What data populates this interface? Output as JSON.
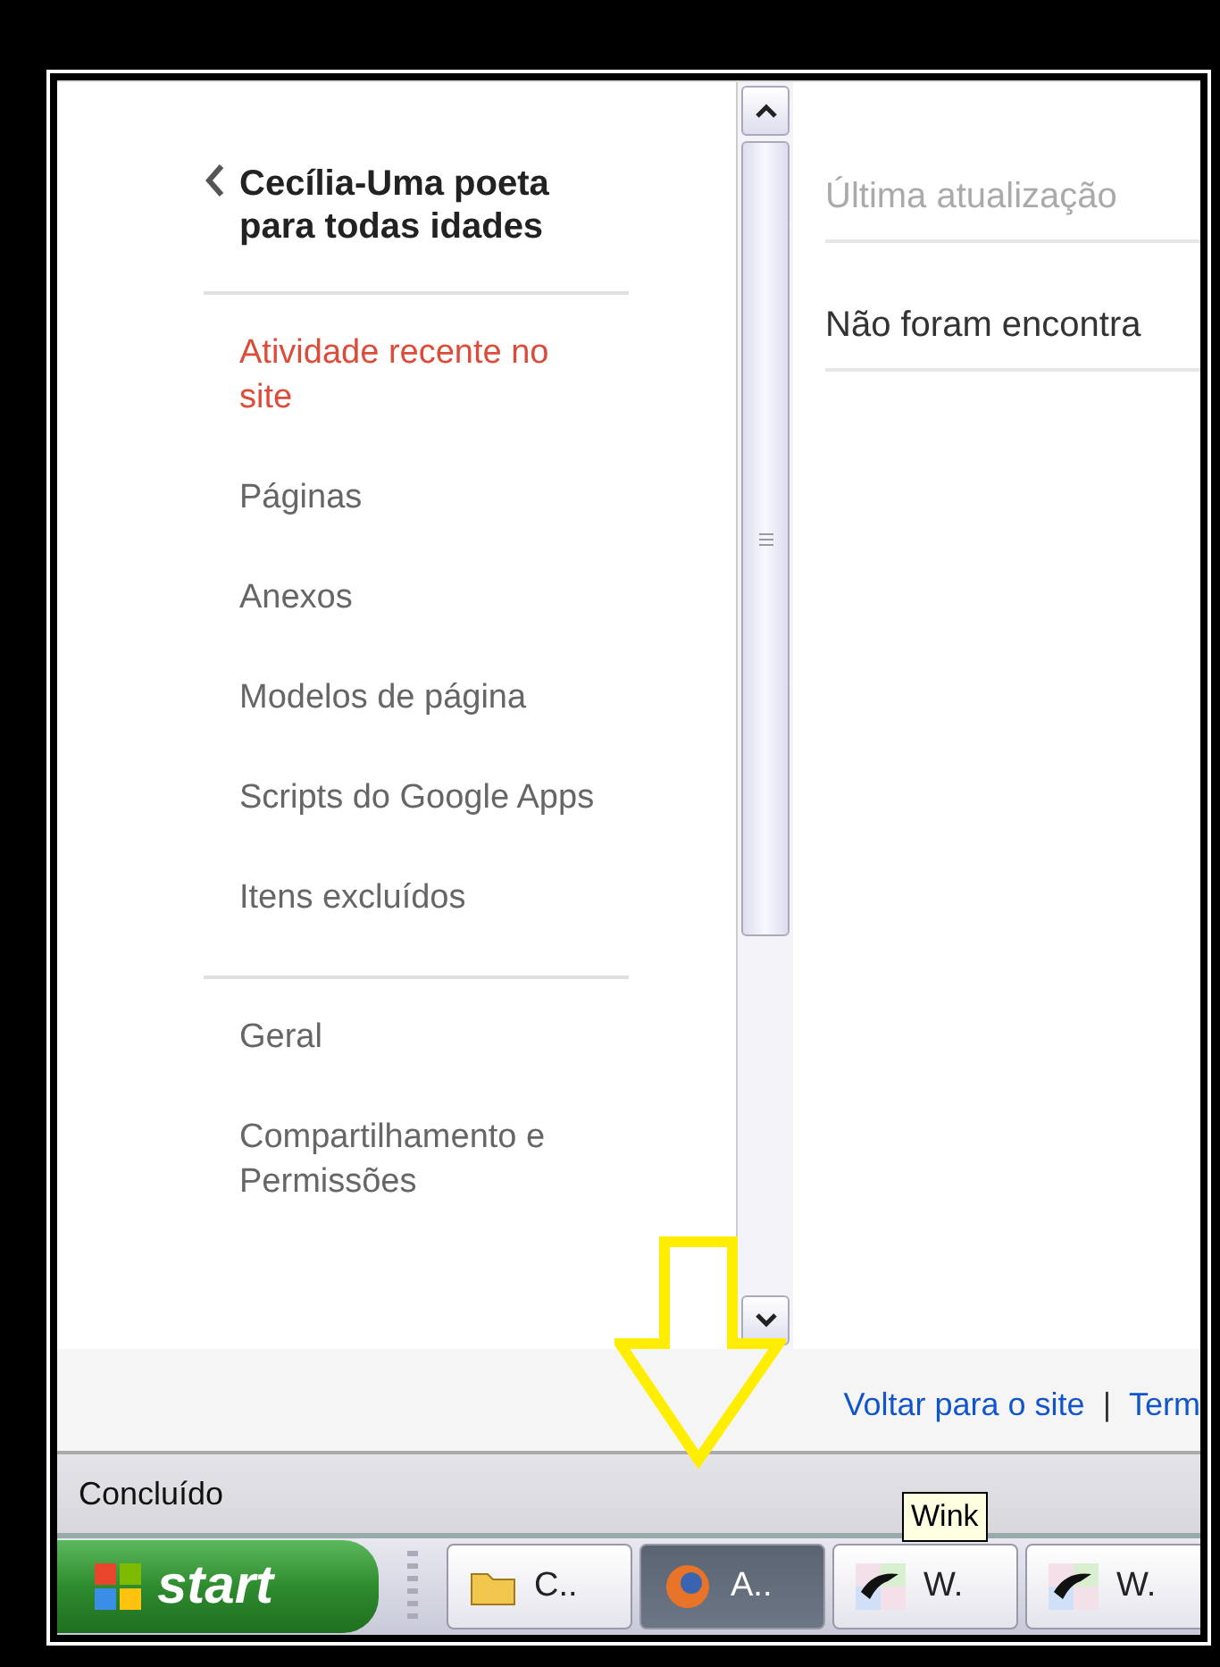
{
  "sidebar": {
    "title": "Cecília-Uma poeta para todas idades",
    "groups": [
      {
        "items": [
          {
            "label": "Atividade recente no site",
            "selected": true
          },
          {
            "label": "Páginas",
            "selected": false
          },
          {
            "label": "Anexos",
            "selected": false
          },
          {
            "label": "Modelos de página",
            "selected": false
          },
          {
            "label": "Scripts do Google Apps",
            "selected": false
          },
          {
            "label": "Itens excluídos",
            "selected": false
          }
        ]
      },
      {
        "items": [
          {
            "label": "Geral",
            "selected": false
          },
          {
            "label": "Compartilhamento e Permissões",
            "selected": false
          }
        ]
      }
    ]
  },
  "main": {
    "header": "Última atualização",
    "message": "Não foram encontra"
  },
  "footer": {
    "links": [
      "Voltar para o site",
      "Term"
    ],
    "separator": "|"
  },
  "status_bar": {
    "text": "Concluído"
  },
  "taskbar": {
    "start": "start",
    "tooltip": "Wink",
    "buttons": [
      {
        "kind": "folder",
        "label": "C..",
        "selected": false
      },
      {
        "kind": "browser",
        "label": "A..",
        "selected": true
      },
      {
        "kind": "wink",
        "label": "W.",
        "selected": false
      },
      {
        "kind": "wink",
        "label": "W.",
        "selected": false
      }
    ]
  }
}
